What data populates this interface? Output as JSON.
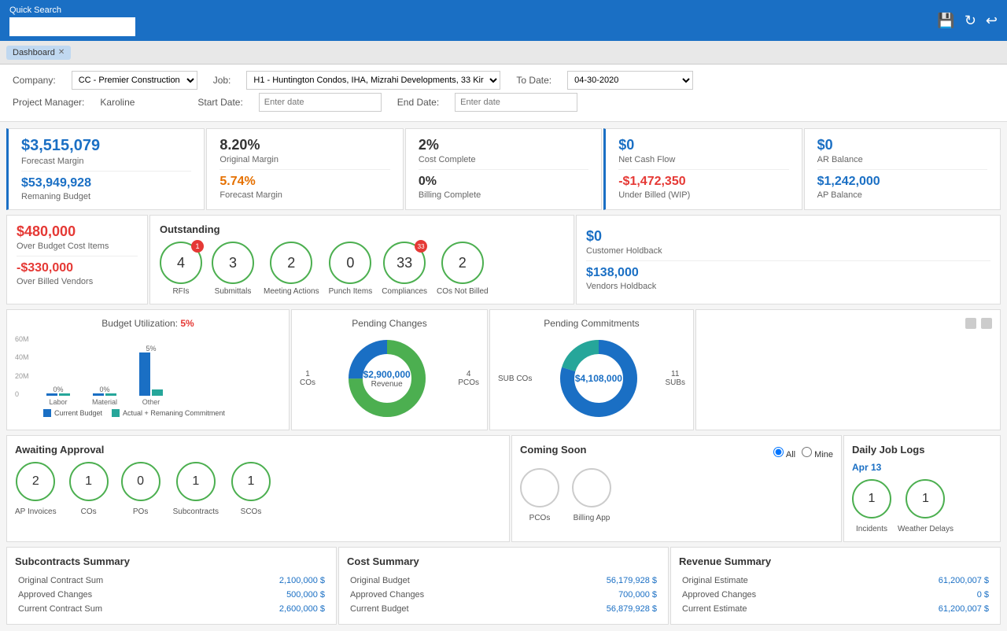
{
  "topbar": {
    "search_label": "Quick Search",
    "search_placeholder": "",
    "icons": [
      "save-icon",
      "refresh-icon",
      "back-icon"
    ]
  },
  "tabs": [
    {
      "label": "x"
    }
  ],
  "filters": {
    "company_label": "Company:",
    "company_value": "CC - Premier Construction",
    "job_label": "Job:",
    "job_value": "H1 - Huntington Condos, IHA, Mizrahi Developments, 33 Kir",
    "todate_label": "To Date:",
    "todate_value": "04-30-2020",
    "pm_label": "Project Manager:",
    "pm_value": "Karoline",
    "startdate_label": "Start Date:",
    "startdate_placeholder": "Enter date",
    "enddate_label": "End Date:",
    "enddate_placeholder": "Enter date"
  },
  "kpi_row1": [
    {
      "value1": "$3,515,079",
      "label1": "Forecast Margin",
      "value2": "$53,949,928",
      "label2": "Remaning Budget",
      "color": "blue"
    },
    {
      "value1": "8.20%",
      "label1": "Original Margin",
      "value2": "5.74%",
      "label2": "Forecast Margin",
      "color": "orange"
    },
    {
      "value1": "2%",
      "label1": "Cost Complete",
      "value2": "0%",
      "label2": "Billing Complete",
      "color": "blue"
    },
    {
      "value1": "$0",
      "label1": "Net Cash Flow",
      "value2": "-$1,472,350",
      "label2": "Under Billed (WIP)",
      "color": "mixed"
    },
    {
      "value1": "$0",
      "label1": "AR Balance",
      "value2": "$1,242,000",
      "label2": "AP Balance",
      "color": "blue"
    }
  ],
  "outstanding": {
    "title": "Outstanding",
    "items": [
      {
        "value": "4",
        "label": "RFIs",
        "badge": "1"
      },
      {
        "value": "3",
        "label": "Submittals",
        "badge": null
      },
      {
        "value": "2",
        "label": "Meeting Actions",
        "badge": null
      },
      {
        "value": "0",
        "label": "Punch Items",
        "badge": null
      },
      {
        "value": "33",
        "label": "Compliances",
        "badge": "33"
      },
      {
        "value": "2",
        "label": "COs Not Billed",
        "badge": null
      }
    ]
  },
  "over_budget": {
    "value1": "$480,000",
    "label1": "Over Budget Cost Items",
    "value2": "-$330,000",
    "label2": "Over Billed Vendors"
  },
  "holdback": {
    "value1": "$0",
    "label1": "Customer Holdback",
    "value2": "$138,000",
    "label2": "Vendors Holdback"
  },
  "budget_chart": {
    "title": "Budget Utilization:",
    "pct": "5%",
    "y_labels": [
      "60M",
      "40M",
      "20M",
      "0"
    ],
    "bars": [
      {
        "x_label": "Labor",
        "pct": "0%",
        "height_blue": 2,
        "height_teal": 2
      },
      {
        "x_label": "Material",
        "pct": "0%",
        "height_blue": 2,
        "height_teal": 2
      },
      {
        "x_label": "Other",
        "pct": "5%",
        "height_blue": 55,
        "height_teal": 8
      }
    ],
    "legend": [
      "Current Budget",
      "Actual + Remaning Commitment"
    ]
  },
  "pending_changes": {
    "title": "Pending Changes",
    "center_value": "$2,900,000",
    "center_sub": "Revenue",
    "left_label": "1\nCOs",
    "right_label": "4\nPCOs",
    "donut_green_pct": 75,
    "donut_blue_pct": 25
  },
  "pending_commitments": {
    "title": "Pending Commitments",
    "center_value": "$4,108,000",
    "left_label": "SUB COs",
    "right_label": "11\nSUBs",
    "donut_blue_pct": 80,
    "donut_teal_pct": 20
  },
  "awaiting_approval": {
    "title": "Awaiting Approval",
    "items": [
      {
        "value": "2",
        "label": "AP Invoices"
      },
      {
        "value": "1",
        "label": "COs"
      },
      {
        "value": "0",
        "label": "POs"
      },
      {
        "value": "1",
        "label": "Subcontracts"
      },
      {
        "value": "1",
        "label": "SCOs"
      }
    ]
  },
  "coming_soon": {
    "title": "Coming Soon",
    "radio_all": "All",
    "radio_mine": "Mine",
    "items": [
      {
        "value": "",
        "label": "PCOs"
      },
      {
        "value": "",
        "label": "Billing App"
      }
    ]
  },
  "daily_logs": {
    "title": "Daily Job Logs",
    "date": "Apr 13",
    "items": [
      {
        "value": "1",
        "label": "Incidents"
      },
      {
        "value": "1",
        "label": "Weather Delays"
      }
    ]
  },
  "subcontracts_summary": {
    "title": "Subcontracts Summary",
    "rows": [
      {
        "label": "Original Contract Sum",
        "value": "2,100,000 $"
      },
      {
        "label": "Approved Changes",
        "value": "500,000 $"
      },
      {
        "label": "Current Contract Sum",
        "value": "2,600,000 $"
      }
    ]
  },
  "cost_summary": {
    "title": "Cost Summary",
    "rows": [
      {
        "label": "Original Budget",
        "value": "56,179,928 $"
      },
      {
        "label": "Approved Changes",
        "value": "700,000 $"
      },
      {
        "label": "Current Budget",
        "value": "56,879,928 $"
      }
    ]
  },
  "revenue_summary": {
    "title": "Revenue Summary",
    "rows": [
      {
        "label": "Original Estimate",
        "value": "61,200,007 $"
      },
      {
        "label": "Approved Changes",
        "value": "0 $"
      },
      {
        "label": "Current Estimate",
        "value": "61,200,007 $"
      }
    ]
  }
}
